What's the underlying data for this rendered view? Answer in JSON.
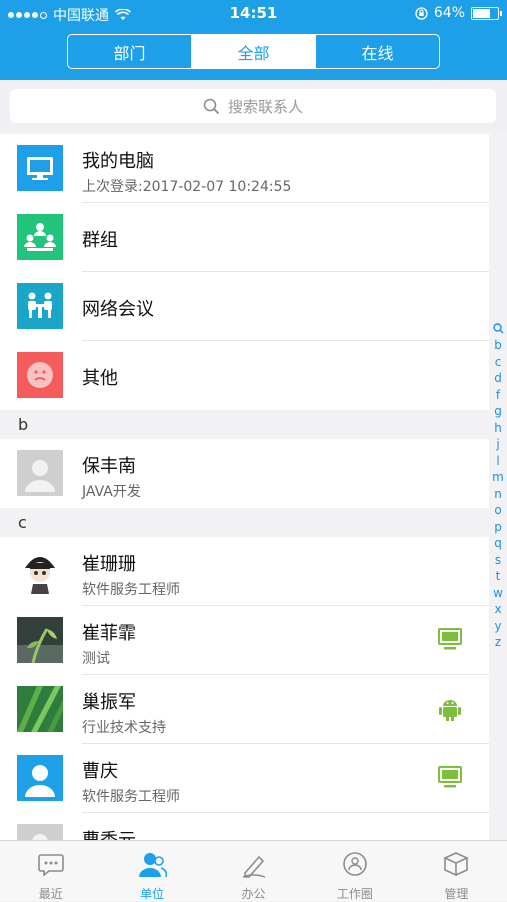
{
  "status_bar": {
    "carrier": "中国联通",
    "time": "14:51",
    "battery": "64%"
  },
  "segments": [
    {
      "label": "部门",
      "active": false
    },
    {
      "label": "全部",
      "active": true
    },
    {
      "label": "在线",
      "active": false
    }
  ],
  "search": {
    "placeholder": "搜索联系人"
  },
  "top_items": [
    {
      "title": "我的电脑",
      "subtitle": "上次登录:2017-02-07 10:24:55",
      "icon": "computer-icon",
      "color": "#1ea0e8"
    },
    {
      "title": "群组",
      "icon": "group-icon",
      "color": "#20c47b"
    },
    {
      "title": "网络会议",
      "icon": "meeting-icon",
      "color": "#1aa6c8"
    },
    {
      "title": "其他",
      "icon": "other-icon",
      "color": "#f45b5b"
    }
  ],
  "sections": [
    {
      "letter": "b",
      "contacts": [
        {
          "name": "保丰南",
          "title": "JAVA开发",
          "avatar": "default-avatar",
          "device": ""
        }
      ]
    },
    {
      "letter": "c",
      "contacts": [
        {
          "name": "崔珊珊",
          "title": "软件服务工程师",
          "avatar": "cartoon-avatar",
          "device": ""
        },
        {
          "name": "崔菲霏",
          "title": "测试",
          "avatar": "photo-plant-avatar",
          "device": "pc-icon"
        },
        {
          "name": "巢振军",
          "title": "行业技术支持",
          "avatar": "photo-leaf-avatar",
          "device": "android-icon"
        },
        {
          "name": "曹庆",
          "title": "软件服务工程师",
          "avatar": "blue-default-avatar",
          "device": "pc-icon"
        },
        {
          "name": "曹秀元",
          "title": "",
          "avatar": "default-avatar",
          "device": ""
        }
      ]
    }
  ],
  "index_letters": [
    "b",
    "c",
    "d",
    "f",
    "g",
    "h",
    "j",
    "l",
    "m",
    "n",
    "o",
    "p",
    "q",
    "s",
    "t",
    "w",
    "x",
    "y",
    "z"
  ],
  "tabs": [
    {
      "label": "最近",
      "icon": "chat-icon",
      "active": false
    },
    {
      "label": "单位",
      "icon": "contacts-icon",
      "active": true
    },
    {
      "label": "办公",
      "icon": "pen-icon",
      "active": false
    },
    {
      "label": "工作圈",
      "icon": "circle-icon",
      "active": false
    },
    {
      "label": "管理",
      "icon": "box-icon",
      "active": false
    }
  ],
  "colors": {
    "brand": "#1ea0e8",
    "device_green": "#7cbf3c"
  }
}
